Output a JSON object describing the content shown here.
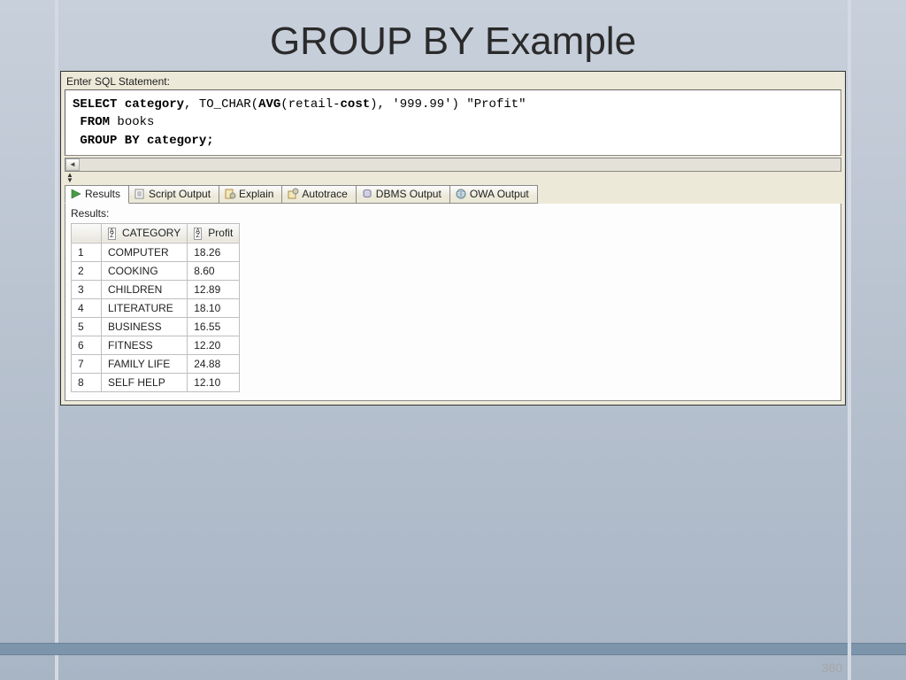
{
  "slide": {
    "title": "GROUP BY Example",
    "page_number": "360"
  },
  "sql": {
    "label": "Enter SQL Statement:",
    "tokens": {
      "select": "SELECT",
      "col1": "category",
      "comma": ",",
      "func": "TO_CHAR(",
      "avg": "AVG",
      "paren_open": "(retail-",
      "cost": "cost",
      "paren_close": ")",
      "comma2": ",",
      "fmt": " '999.99') \"Profit\"",
      "from": " FROM",
      "table": " books",
      "groupby": " GROUP BY",
      "gcol": " category;"
    }
  },
  "tabs": {
    "results": "Results",
    "script": "Script Output",
    "explain": "Explain",
    "autotrace": "Autotrace",
    "dbms": "DBMS Output",
    "owa": "OWA Output"
  },
  "results": {
    "label": "Results:",
    "columns": {
      "category": "CATEGORY",
      "profit": "Profit"
    },
    "rows": [
      {
        "n": "1",
        "category": "COMPUTER",
        "profit": "18.26"
      },
      {
        "n": "2",
        "category": "COOKING",
        "profit": "8.60"
      },
      {
        "n": "3",
        "category": "CHILDREN",
        "profit": "12.89"
      },
      {
        "n": "4",
        "category": "LITERATURE",
        "profit": "18.10"
      },
      {
        "n": "5",
        "category": "BUSINESS",
        "profit": "16.55"
      },
      {
        "n": "6",
        "category": "FITNESS",
        "profit": "12.20"
      },
      {
        "n": "7",
        "category": "FAMILY LIFE",
        "profit": "24.88"
      },
      {
        "n": "8",
        "category": "SELF HELP",
        "profit": "12.10"
      }
    ]
  }
}
